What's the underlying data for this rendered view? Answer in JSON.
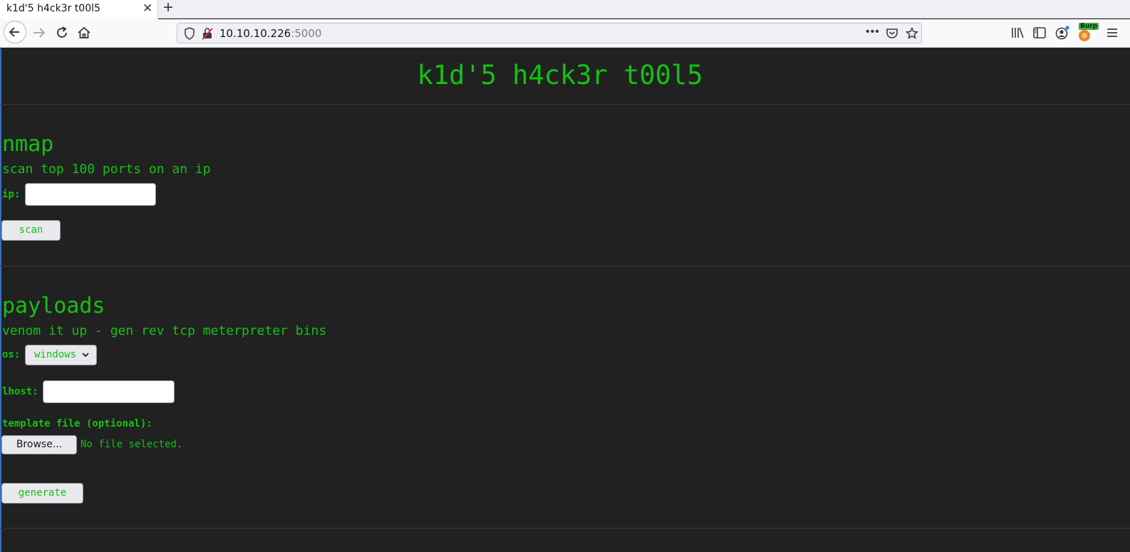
{
  "browser": {
    "tab_title": "k1d'5 h4ck3r t00l5",
    "url_host": "10.10.10.226",
    "url_port": ":5000",
    "burp_label": "Burp"
  },
  "page": {
    "title": "k1d'5 h4ck3r t00l5",
    "nmap": {
      "heading": "nmap",
      "description": "scan top 100 ports on an ip",
      "ip_label": "ip:",
      "ip_value": "",
      "scan_button": "scan"
    },
    "payloads": {
      "heading": "payloads",
      "description": "venom it up - gen rev tcp meterpreter bins",
      "os_label": "os:",
      "os_selected": "windows",
      "lhost_label": "lhost:",
      "lhost_value": "",
      "template_label": "template file (optional):",
      "browse_button": "Browse...",
      "file_status": "No file selected.",
      "generate_button": "generate"
    }
  },
  "colors": {
    "page_background": "#212121",
    "accent_green": "#13c213"
  }
}
